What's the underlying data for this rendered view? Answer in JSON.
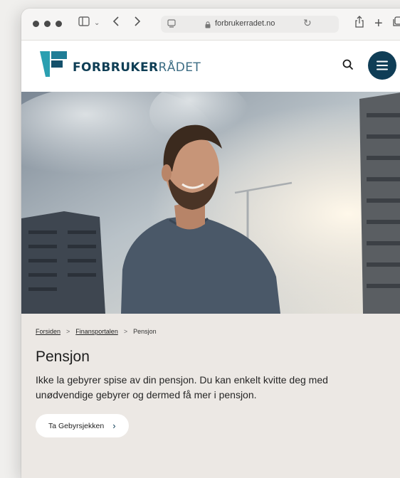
{
  "browser": {
    "url": "forbrukerradet.no"
  },
  "site": {
    "brand_bold": "FORBRUKER",
    "brand_light": "RÅDET"
  },
  "breadcrumb": {
    "items": [
      "Forsiden",
      "Finansportalen",
      "Pensjon"
    ],
    "separator": ">"
  },
  "page": {
    "title": "Pensjon",
    "lede": "Ikke la gebyrer spise av din pensjon. Du kan enkelt kvitte deg med unødvendige gebyrer og dermed få mer i pensjon.",
    "cta_label": "Ta Gebyrsjekken",
    "cta_chevron": "›"
  },
  "colors": {
    "brand_dark": "#0f3d56",
    "brand_teal": "#2a9fb0",
    "page_bg": "#ece8e4"
  },
  "icons": [
    "traffic-lights",
    "sidebar-icon",
    "chevron-down-icon",
    "back-icon",
    "forward-icon",
    "reader-icon",
    "lock-icon",
    "reload-icon",
    "share-icon",
    "new-tab-icon",
    "tabs-icon",
    "search-icon",
    "menu-icon",
    "chevron-right-icon"
  ]
}
